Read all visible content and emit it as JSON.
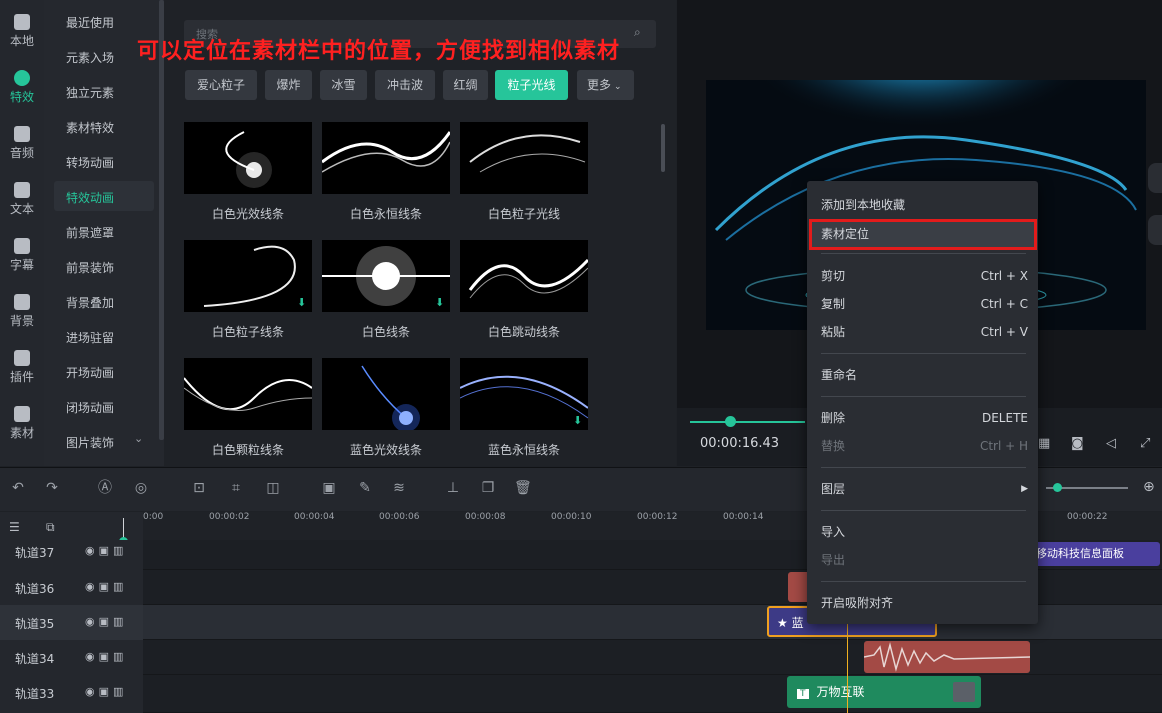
{
  "sidebar_tabs": [
    {
      "label": "本地",
      "icon": "film-icon"
    },
    {
      "label": "特效",
      "icon": "sparkle-icon"
    },
    {
      "label": "音频",
      "icon": "music-icon"
    },
    {
      "label": "文本",
      "icon": "text-icon"
    },
    {
      "label": "字幕",
      "icon": "caption-icon"
    },
    {
      "label": "背景",
      "icon": "background-icon"
    },
    {
      "label": "插件",
      "icon": "puzzle-icon"
    },
    {
      "label": "素材",
      "icon": "folder-icon"
    }
  ],
  "categories": [
    "最近使用",
    "元素入场",
    "独立元素",
    "素材特效",
    "转场动画",
    "特效动画",
    "前景遮罩",
    "前景装饰",
    "背景叠加",
    "进场驻留",
    "开场动画",
    "闭场动画",
    "图片装饰"
  ],
  "search": {
    "placeholder": "搜索"
  },
  "overlay_annotation": "可以定位在素材栏中的位置，方便找到相似素材",
  "filter_tags": [
    "爱心粒子",
    "爆炸",
    "冰雪",
    "冲击波",
    "红绸",
    "粒子光线",
    "更多"
  ],
  "assets": [
    "白色光效线条",
    "白色永恒线条",
    "白色粒子光线",
    "白色粒子线条",
    "白色线条",
    "白色跳动线条",
    "白色颗粒线条",
    "蓝色光效线条",
    "蓝色永恒线条"
  ],
  "preview": {
    "timecode": "00:00:16.43"
  },
  "timeline": {
    "ruler": [
      "0:00",
      "00:00:02",
      "00:00:04",
      "00:00:06",
      "00:00:08",
      "00:00:10",
      "00:00:12",
      "00:00:14",
      "00:00:22"
    ],
    "tracks": [
      "轨道37",
      "轨道36",
      "轨道35",
      "轨道34",
      "轨道33"
    ],
    "clip_text_top": "移动科技信息面板",
    "clip_text_effect": "蓝",
    "clip_text_title": "万物互联"
  },
  "context_menu": {
    "items": [
      {
        "label": "添加到本地收藏",
        "shortcut": ""
      },
      {
        "label": "素材定位",
        "shortcut": ""
      },
      {
        "label": "剪切",
        "shortcut": "Ctrl + X"
      },
      {
        "label": "复制",
        "shortcut": "Ctrl + C"
      },
      {
        "label": "粘贴",
        "shortcut": "Ctrl + V"
      },
      {
        "label": "重命名",
        "shortcut": ""
      },
      {
        "label": "删除",
        "shortcut": "DELETE"
      },
      {
        "label": "替换",
        "shortcut": "Ctrl + H"
      },
      {
        "label": "图层",
        "shortcut": "▶"
      },
      {
        "label": "导入",
        "shortcut": ""
      },
      {
        "label": "导出",
        "shortcut": ""
      },
      {
        "label": "开启吸附对齐",
        "shortcut": ""
      }
    ]
  },
  "colors": {
    "accent": "#26c59a",
    "highlight_box": "#e31b1b",
    "annotation": "#ff2020"
  }
}
